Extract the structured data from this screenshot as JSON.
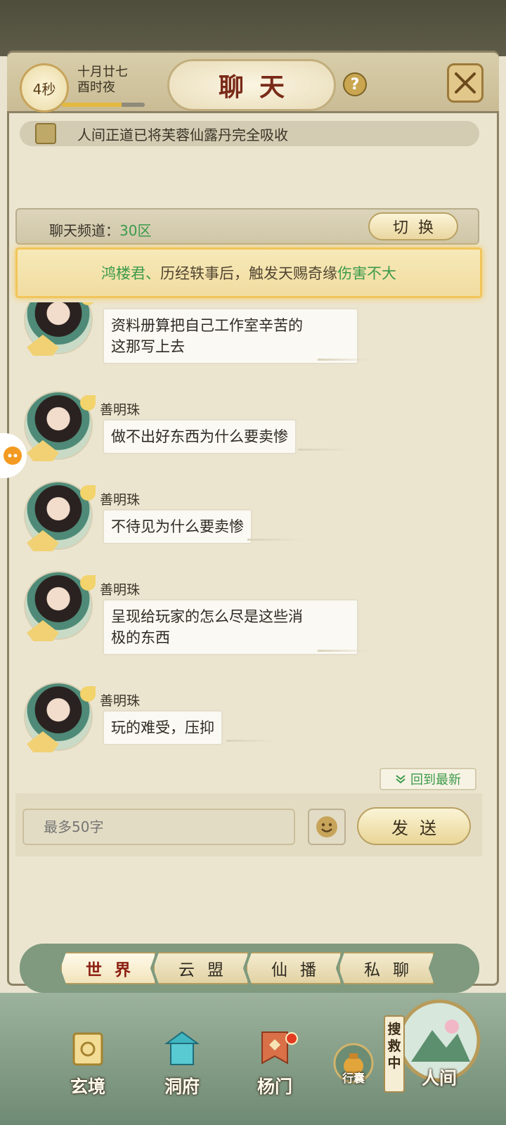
{
  "header": {
    "timer": "4秒",
    "date_line1": "十月廿七",
    "date_line2": "酉时夜",
    "progress": 0.72,
    "title": "聊天",
    "help_label": "?"
  },
  "notice": {
    "text": "人间正道已将芙蓉仙露丹完全吸收"
  },
  "channel": {
    "label": "聊天频道：",
    "value": "30区",
    "switch_label": "切换"
  },
  "announcement": {
    "part1": "鸿楼君、历经轶事后，触发天赐奇缘",
    "part2": "伤害不大"
  },
  "messages": [
    {
      "sender": "",
      "text_line1": "资料册算把自己工作室辛苦的",
      "text_line2": "这那写上去"
    },
    {
      "sender": "善明珠",
      "text_line1": "做不出好东西为什么要卖惨",
      "text_line2": ""
    },
    {
      "sender": "善明珠",
      "text_line1": "不待见为什么要卖惨",
      "text_line2": ""
    },
    {
      "sender": "善明珠",
      "text_line1": "呈现给玩家的怎么尽是这些消",
      "text_line2": "极的东西"
    },
    {
      "sender": "善明珠",
      "text_line1": "玩的难受，压抑",
      "text_line2": ""
    }
  ],
  "back_latest": "回到最新",
  "input": {
    "placeholder": "最多50字",
    "send_label": "发送"
  },
  "tabs": [
    {
      "label": "世界",
      "active": true
    },
    {
      "label": "云盟",
      "active": false
    },
    {
      "label": "仙播",
      "active": false
    },
    {
      "label": "私聊",
      "active": false
    }
  ],
  "bottom_nav": [
    {
      "label": "玄境"
    },
    {
      "label": "洞府"
    },
    {
      "label": "杨门"
    },
    {
      "label": "行囊"
    },
    {
      "label": "人间"
    }
  ],
  "search_tag": "搜救中",
  "colors": {
    "accent_green": "#3c9a4b",
    "title_red": "#7a2a18",
    "notify_red": "#e23b22"
  }
}
